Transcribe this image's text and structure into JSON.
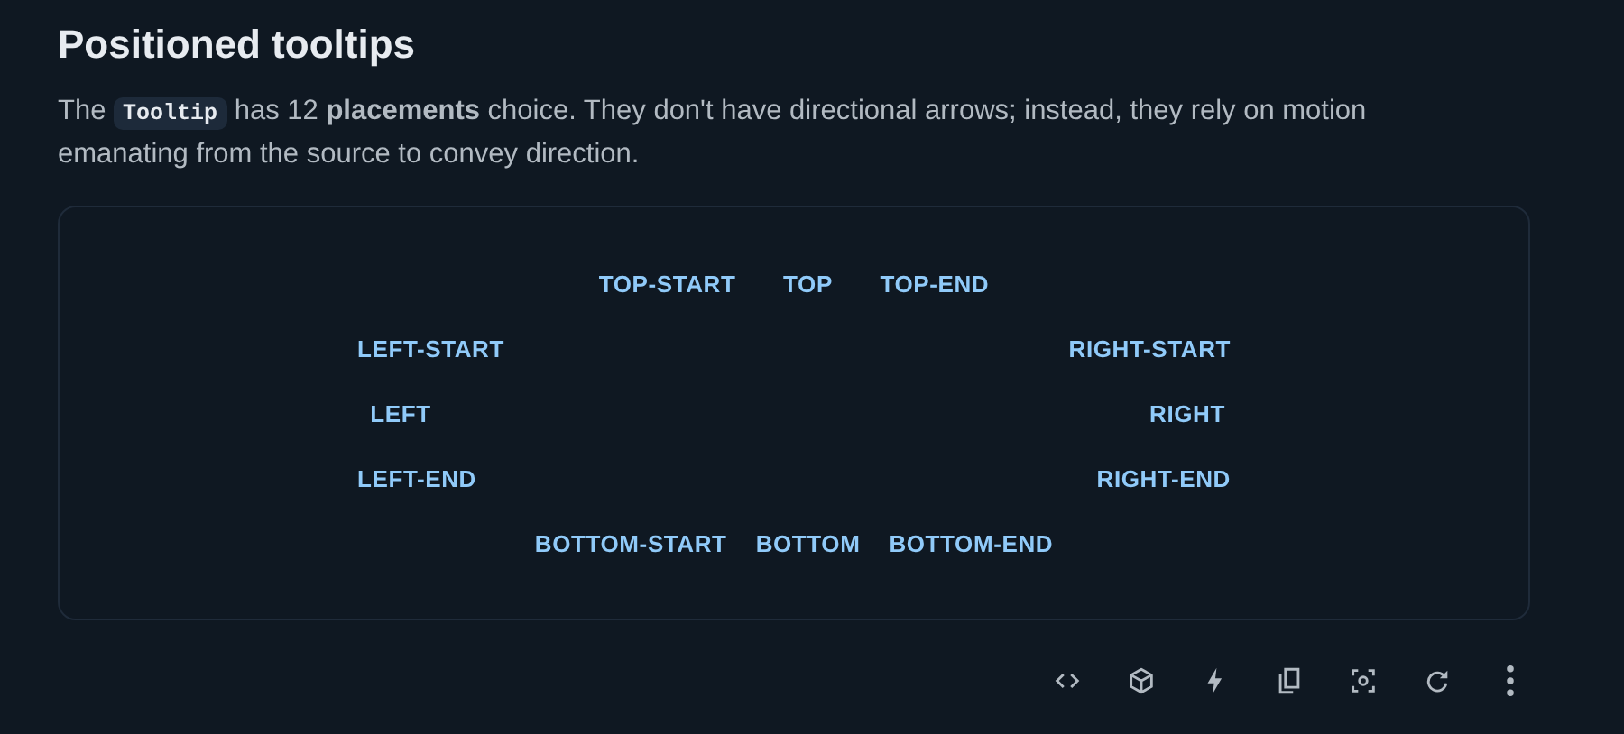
{
  "heading": "Positioned tooltips",
  "description": {
    "before": "The",
    "code": "Tooltip",
    "after": "has 12 **placements** choice. They don't have directional arrows; instead, they rely on motion emanating from the source to convey direction."
  },
  "demo": {
    "top": [
      "TOP-START",
      "TOP",
      "TOP-END"
    ],
    "sides": [
      {
        "left": "LEFT-START",
        "right": "RIGHT-START"
      },
      {
        "left": "LEFT",
        "right": "RIGHT"
      },
      {
        "left": "LEFT-END",
        "right": "RIGHT-END"
      }
    ],
    "bottom": [
      "BOTTOM-START",
      "BOTTOM",
      "BOTTOM-END"
    ]
  }
}
